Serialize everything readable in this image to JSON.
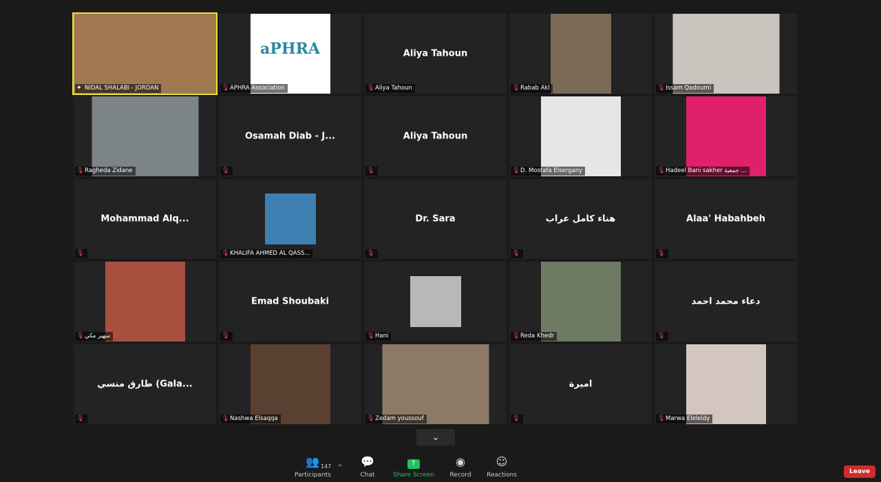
{
  "participants": [
    {
      "name": "NIDAL SHALABI - JORDAN",
      "video": true,
      "active": true,
      "pinned": true,
      "bg": "#a07850"
    },
    {
      "name": "APHRA Association",
      "video": true,
      "logo": "aPHRA",
      "bg": "#ffffff"
    },
    {
      "name": "Aliya Tahoun",
      "display": "Aliya Tahoun",
      "video": false
    },
    {
      "name": "Rabab Akl",
      "video": true,
      "bg": "#7a6a55"
    },
    {
      "name": "Issam Qadoumi",
      "video": true,
      "bg": "#c9c4bd"
    },
    {
      "name": "Ragheda Zidane",
      "video": true,
      "bg": "#7d8488"
    },
    {
      "name": "",
      "display": "Osamah Diab - J...",
      "video": false
    },
    {
      "name": "",
      "display": "Aliya Tahoun",
      "video": false
    },
    {
      "name": "D. Mostafa Elsergany",
      "video": true,
      "bg": "#e8e6e4"
    },
    {
      "name": "Hadeel Bani sakher جمعية ...",
      "video": true,
      "bg": "#e0206a"
    },
    {
      "name": "",
      "display": "Mohammad  Alq...",
      "video": false
    },
    {
      "name": "KHALIFA AHMED AL QASS...",
      "video": true,
      "bg": "#3c7fb0"
    },
    {
      "name": "",
      "display": "Dr. Sara",
      "video": false
    },
    {
      "name": "",
      "display": "هناء كامل عراب",
      "video": false
    },
    {
      "name": "",
      "display": "Alaa' Habahbeh",
      "video": false
    },
    {
      "name": "سهير مكي",
      "video": true,
      "bg": "#a85040"
    },
    {
      "name": "",
      "display": "Emad Shoubaki",
      "video": false
    },
    {
      "name": "Hani",
      "video": true,
      "bg": "#b8b8b8"
    },
    {
      "name": "Reda Khedr",
      "video": true,
      "bg": "#6f7a62"
    },
    {
      "name": "",
      "display": "دعاء محمد احمد",
      "video": false
    },
    {
      "name": "",
      "display": "طارق منسي (Gala...",
      "video": false
    },
    {
      "name": "Nashwa Elsaqqa",
      "video": true,
      "bg": "#5a4030"
    },
    {
      "name": "Zedam youssouf",
      "video": true,
      "bg": "#8c7a66"
    },
    {
      "name": "",
      "display": "اميرة",
      "video": false
    },
    {
      "name": "Marwa Eleleidy",
      "video": true,
      "bg": "#d2c6bf"
    }
  ],
  "toolbar": {
    "participants_label": "Participants",
    "participants_count": "147",
    "chat_label": "Chat",
    "share_label": "Share Screen",
    "record_label": "Record",
    "reactions_label": "Reactions",
    "leave_label": "Leave"
  },
  "colors": {
    "active": "#e6e33b",
    "share": "#1ec35a",
    "leave": "#d32b2b",
    "mic_muted": "#e04848"
  }
}
